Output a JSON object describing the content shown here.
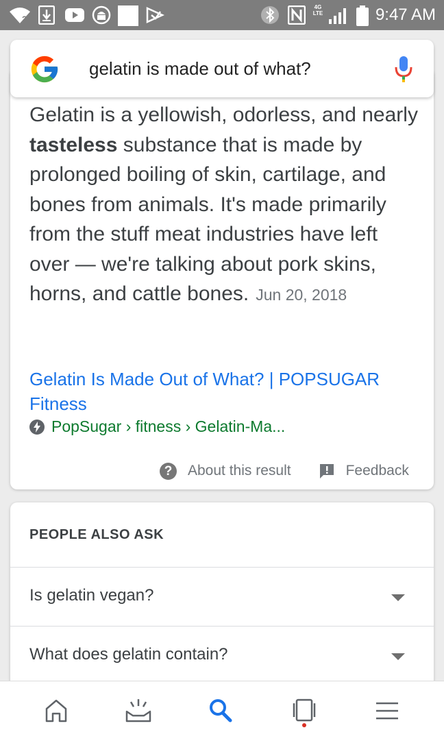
{
  "status_bar": {
    "time": "9:47 AM",
    "network_label": "4G LTE",
    "icons": [
      "wifi-icon",
      "download-icon",
      "youtube-icon",
      "android-icon",
      "square-icon",
      "send-icon",
      "bluetooth-icon",
      "nfc-icon",
      "signal-icon",
      "battery-icon"
    ]
  },
  "search": {
    "query": "gelatin is made out of what?",
    "logo": "google-logo-icon",
    "mic": "mic-icon"
  },
  "result": {
    "snippet_before_bold": "Gelatin is a yellowish, odorless, and nearly ",
    "snippet_bold": "tasteless",
    "snippet_after_bold": " substance that is made by prolonged boiling of skin, cartilage, and bones from animals. It's made primarily from the stuff meat industries have left over — we're talking about pork skins, horns, and cattle bones.",
    "date": "Jun 20, 2018",
    "link_title": "Gelatin Is Made Out of What? | POPSUGAR Fitness",
    "breadcrumb": "PopSugar › fitness › Gelatin-Ma...",
    "about_label": "About this result",
    "feedback_label": "Feedback"
  },
  "people_also_ask": {
    "title": "PEOPLE ALSO ASK",
    "questions": [
      "Is gelatin vegan?",
      "What does gelatin contain?"
    ]
  },
  "bottom_nav": {
    "items": [
      "home-icon",
      "updates-icon",
      "search-icon",
      "recent-tabs-icon",
      "menu-icon"
    ],
    "active": "search-icon",
    "colors": {
      "active": "#1a73e8",
      "inactive": "#5f6368",
      "badge": "#d93025"
    }
  },
  "colors": {
    "link": "#1a73e8",
    "url_green": "#0d7a2e",
    "status_bar": "#7d7d7d",
    "background": "#ececec"
  }
}
